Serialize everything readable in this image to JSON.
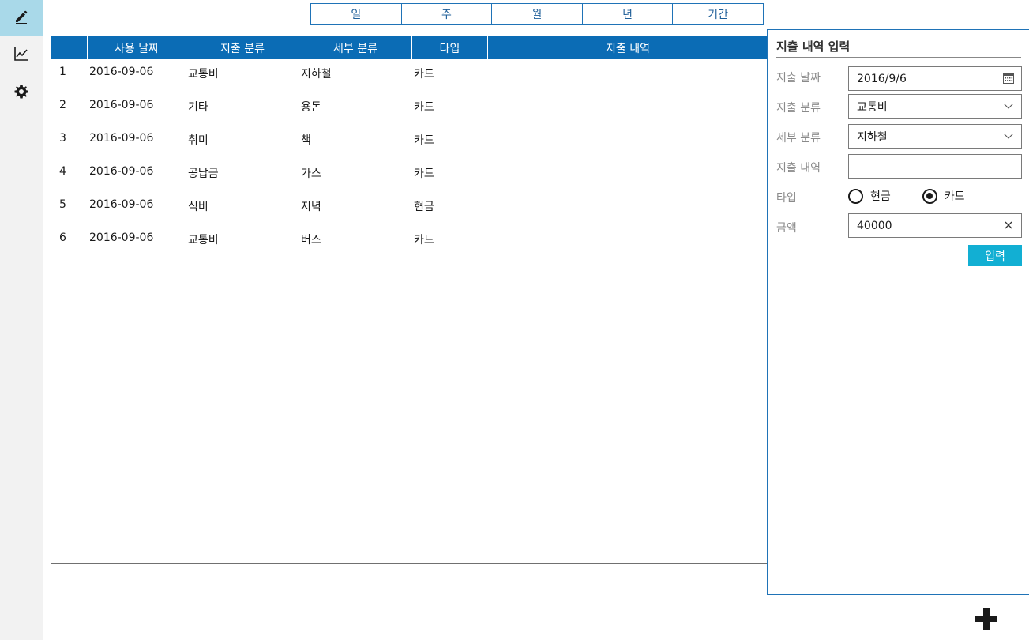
{
  "sidebar": {
    "items": [
      {
        "icon": "pencil-icon",
        "active": true
      },
      {
        "icon": "chart-icon",
        "active": false
      },
      {
        "icon": "gear-icon",
        "active": false
      }
    ]
  },
  "period_tabs": [
    "일",
    "주",
    "월",
    "년",
    "기간"
  ],
  "table": {
    "headers": [
      "",
      "사용 날짜",
      "지출 분류",
      "세부 분류",
      "타입",
      "지출 내역"
    ],
    "rows": [
      {
        "no": "1",
        "date": "2016-09-06",
        "category": "교통비",
        "subcategory": "지하철",
        "type": "카드",
        "detail": ""
      },
      {
        "no": "2",
        "date": "2016-09-06",
        "category": "기타",
        "subcategory": "용돈",
        "type": "카드",
        "detail": ""
      },
      {
        "no": "3",
        "date": "2016-09-06",
        "category": "취미",
        "subcategory": "책",
        "type": "카드",
        "detail": ""
      },
      {
        "no": "4",
        "date": "2016-09-06",
        "category": "공납금",
        "subcategory": "가스",
        "type": "카드",
        "detail": ""
      },
      {
        "no": "5",
        "date": "2016-09-06",
        "category": "식비",
        "subcategory": "저녁",
        "type": "현금",
        "detail": ""
      },
      {
        "no": "6",
        "date": "2016-09-06",
        "category": "교통비",
        "subcategory": "버스",
        "type": "카드",
        "detail": ""
      }
    ]
  },
  "form": {
    "title": "지출 내역 입력",
    "date_label": "지출 날짜",
    "date_value": "2016/9/6",
    "category_label": "지출 분류",
    "category_value": "교통비",
    "subcategory_label": "세부 분류",
    "subcategory_value": "지하철",
    "detail_label": "지출 내역",
    "detail_value": "",
    "type_label": "타입",
    "type_options": [
      "현금",
      "카드"
    ],
    "type_selected": "카드",
    "amount_label": "금액",
    "amount_value": "40000",
    "submit_label": "입력"
  },
  "colors": {
    "accent": "#0b6cb5",
    "sidebar_active": "#a9d9e9",
    "submit": "#12afd3"
  }
}
